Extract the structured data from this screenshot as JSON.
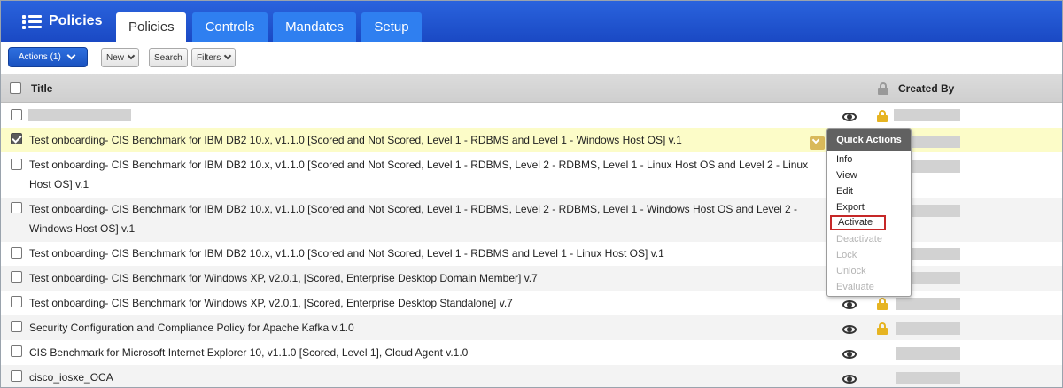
{
  "header": {
    "app_title": "Policies",
    "tabs": [
      {
        "label": "Policies",
        "active": true
      },
      {
        "label": "Controls",
        "active": false
      },
      {
        "label": "Mandates",
        "active": false
      },
      {
        "label": "Setup",
        "active": false
      }
    ]
  },
  "toolbar": {
    "actions_label": "Actions (1)",
    "new_label": "New",
    "search_label": "Search",
    "filters_label": "Filters"
  },
  "table": {
    "columns": {
      "title": "Title",
      "created_by": "Created By"
    },
    "rows": [
      {
        "title": ""
      },
      {
        "title": "Test onboarding- CIS Benchmark for IBM DB2 10.x, v1.1.0 [Scored and Not Scored, Level 1 - RDBMS and Level 1 - Windows Host OS] v.1"
      },
      {
        "title": "Test onboarding- CIS Benchmark for IBM DB2 10.x, v1.1.0 [Scored and Not Scored, Level 1 - RDBMS, Level 2 - RDBMS, Level 1 - Linux Host OS and Level 2 - Linux Host OS] v.1"
      },
      {
        "title": "Test onboarding- CIS Benchmark for IBM DB2 10.x, v1.1.0 [Scored and Not Scored, Level 1 - RDBMS, Level 2 - RDBMS, Level 1 - Windows Host OS and Level 2 - Windows Host OS] v.1"
      },
      {
        "title": "Test onboarding- CIS Benchmark for IBM DB2 10.x, v1.1.0 [Scored and Not Scored, Level 1 - RDBMS and Level 1 - Linux Host OS] v.1"
      },
      {
        "title": "Test onboarding- CIS Benchmark for Windows XP, v2.0.1, [Scored, Enterprise Desktop Domain Member] v.7"
      },
      {
        "title": "Test onboarding- CIS Benchmark for Windows XP, v2.0.1, [Scored, Enterprise Desktop Standalone] v.7"
      },
      {
        "title": "Security Configuration and Compliance Policy for Apache Kafka v.1.0"
      },
      {
        "title": "CIS Benchmark for Microsoft Internet Explorer 10, v1.1.0 [Scored, Level 1], Cloud Agent v.1.0"
      },
      {
        "title": "cisco_iosxe_OCA"
      }
    ]
  },
  "quick_actions": {
    "title": "Quick Actions",
    "items": [
      {
        "label": "Info",
        "enabled": true
      },
      {
        "label": "View",
        "enabled": true
      },
      {
        "label": "Edit",
        "enabled": true
      },
      {
        "label": "Export",
        "enabled": true
      },
      {
        "label": "Activate",
        "enabled": true
      },
      {
        "label": "Deactivate",
        "enabled": false
      },
      {
        "label": "Lock",
        "enabled": false
      },
      {
        "label": "Unlock",
        "enabled": false
      },
      {
        "label": "Evaluate",
        "enabled": false
      }
    ]
  },
  "colors": {
    "header_blue": "#1a49c4",
    "tab_blue": "#2f7ff0",
    "selected_row": "#fcfcc8",
    "lock_gold": "#e6b422",
    "highlight_red": "#c62828"
  }
}
